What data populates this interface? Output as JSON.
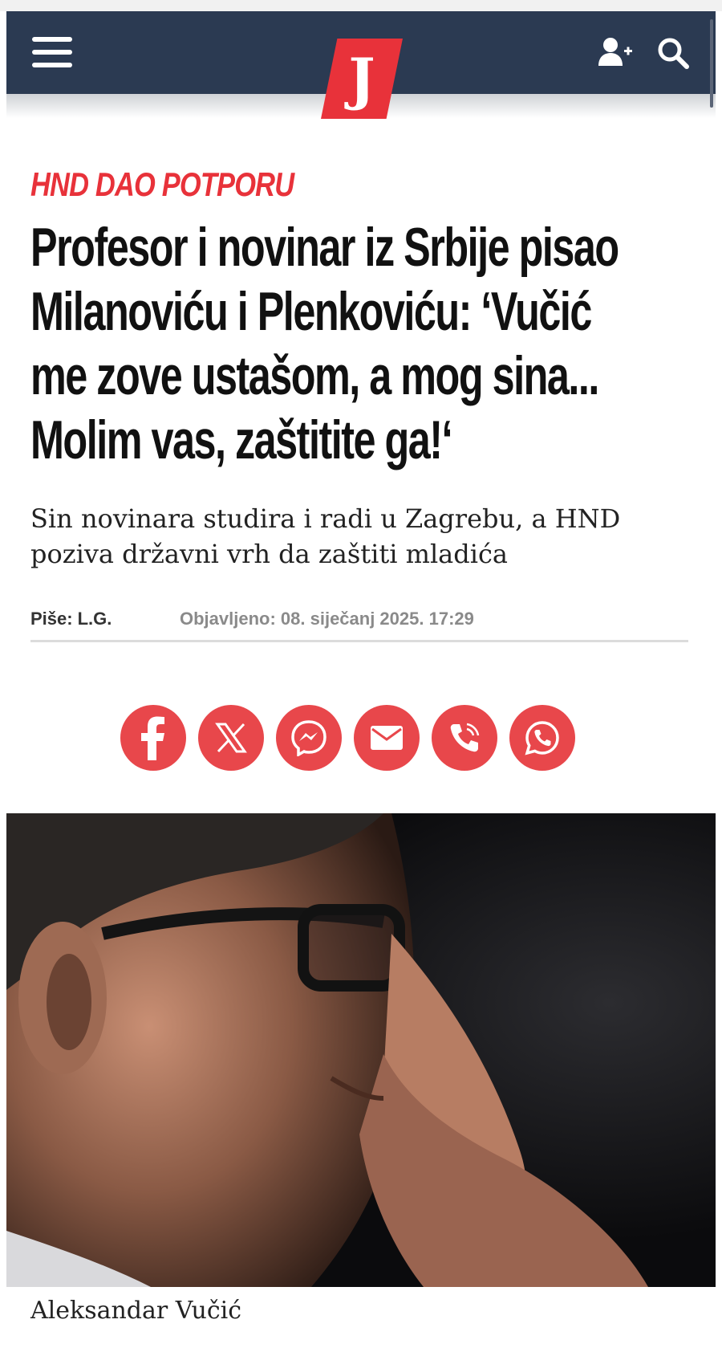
{
  "header": {
    "logo_letter": "J",
    "menu_icon": "hamburger-menu-icon",
    "user_icon": "add-user-icon",
    "search_icon": "search-icon",
    "brand_color": "#e8323a",
    "navbar_color": "#2b3a52"
  },
  "article": {
    "kicker": "HND DAO POTPORU",
    "headline_lines": [
      "Profesor i novinar iz Srbije pisao",
      "Milanoviću i Plenkoviću: ‘Vučić",
      "me zove ustašom, a mog sina...",
      "Molim vas, zaštitite ga!‘"
    ],
    "subheading": "Sin novinara studira i radi u Zagrebu, a HND poziva državni vrh da zaštiti mladića",
    "author_label": "Piše:",
    "author": "L.G.",
    "published": "Objavljeno: 08. siječanj 2025. 17:29"
  },
  "share": {
    "buttons": [
      {
        "icon": "facebook-icon"
      },
      {
        "icon": "x-twitter-icon"
      },
      {
        "icon": "messenger-icon"
      },
      {
        "icon": "email-icon"
      },
      {
        "icon": "viber-icon"
      },
      {
        "icon": "whatsapp-icon"
      }
    ],
    "button_color": "#e8474b"
  },
  "photo": {
    "caption": "Aleksandar Vučić"
  }
}
